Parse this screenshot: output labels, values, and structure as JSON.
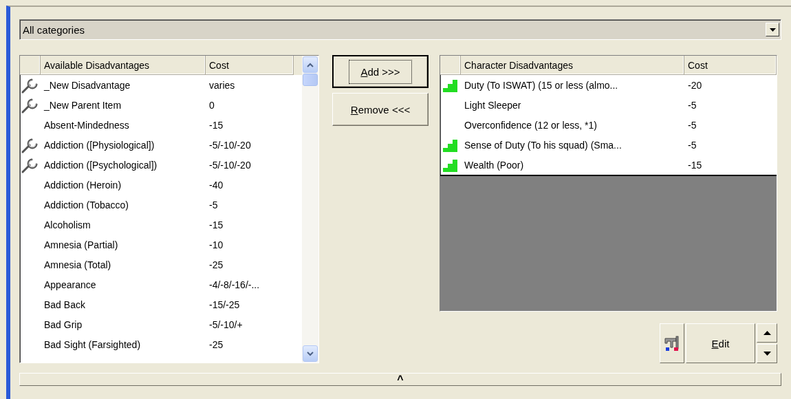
{
  "category_dropdown": {
    "value": "All categories"
  },
  "available_list": {
    "columns": [
      "Available Disadvantages",
      "Cost"
    ],
    "rows": [
      {
        "name": "_New Disadvantage",
        "cost": "varies",
        "kind": "template"
      },
      {
        "name": "_New Parent Item",
        "cost": "0",
        "kind": "template"
      },
      {
        "name": "Absent-Mindedness",
        "cost": "-15",
        "kind": "plain"
      },
      {
        "name": "Addiction ([Physiological])",
        "cost": "-5/-10/-20",
        "kind": "template"
      },
      {
        "name": "Addiction ([Psychological])",
        "cost": "-5/-10/-20",
        "kind": "template"
      },
      {
        "name": "Addiction (Heroin)",
        "cost": "-40",
        "kind": "plain"
      },
      {
        "name": "Addiction (Tobacco)",
        "cost": "-5",
        "kind": "plain"
      },
      {
        "name": "Alcoholism",
        "cost": "-15",
        "kind": "plain"
      },
      {
        "name": "Amnesia (Partial)",
        "cost": "-10",
        "kind": "plain"
      },
      {
        "name": "Amnesia (Total)",
        "cost": "-25",
        "kind": "plain"
      },
      {
        "name": "Appearance",
        "cost": "-4/-8/-16/-...",
        "kind": "plain"
      },
      {
        "name": "Bad Back",
        "cost": "-15/-25",
        "kind": "plain"
      },
      {
        "name": "Bad Grip",
        "cost": "-5/-10/+",
        "kind": "plain"
      },
      {
        "name": "Bad Sight (Farsighted)",
        "cost": "-25",
        "kind": "plain"
      }
    ]
  },
  "buttons": [
    {
      "label": "Add >>>",
      "focused": true
    },
    {
      "label": "Remove <<<",
      "focused": false
    }
  ],
  "character_list": {
    "columns": [
      "Character Disadvantages",
      "Cost"
    ],
    "rows": [
      {
        "name": "Duty (To ISWAT) (15 or less (almo...",
        "cost": "-20",
        "kind": "leveled"
      },
      {
        "name": "Light Sleeper",
        "cost": "-5",
        "kind": "plain"
      },
      {
        "name": "Overconfidence (12 or less, *1)",
        "cost": "-5",
        "kind": "plain"
      },
      {
        "name": "Sense of Duty (To his squad) (Sma...",
        "cost": "-5",
        "kind": "leveled"
      },
      {
        "name": "Wealth (Poor)",
        "cost": "-15",
        "kind": "leveled"
      }
    ]
  },
  "edit_button": {
    "label": "Edit"
  },
  "bottom_bar": {
    "icon": "^"
  }
}
